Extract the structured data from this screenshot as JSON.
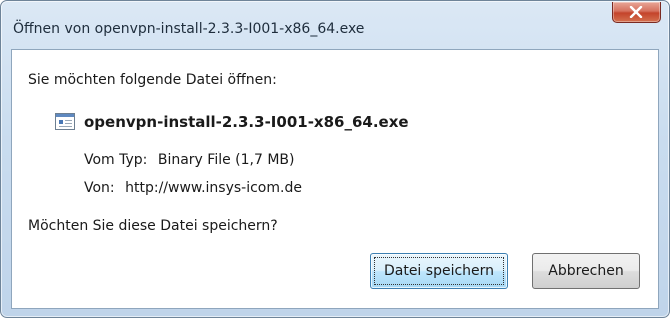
{
  "window": {
    "title": "Öffnen von openvpn-install-2.3.3-I001-x86_64.exe",
    "close_icon": "close-icon"
  },
  "dialog": {
    "prompt": "Sie möchten folgende Datei öffnen:",
    "file_icon": "exe-file-icon",
    "filename": "openvpn-install-2.3.3-I001-x86_64.exe",
    "type_label": "Vom Typ:",
    "type_value": "Binary File (1,7 MB)",
    "source_label": "Von:",
    "source_value": "http://www.insys-icom.de",
    "question": "Möchten Sie diese Datei speichern?"
  },
  "buttons": {
    "save": "Datei speichern",
    "cancel": "Abbrechen"
  },
  "colors": {
    "frame": "#c9dcef",
    "close_button": "#c4432b",
    "default_button": "#bee6fd"
  }
}
